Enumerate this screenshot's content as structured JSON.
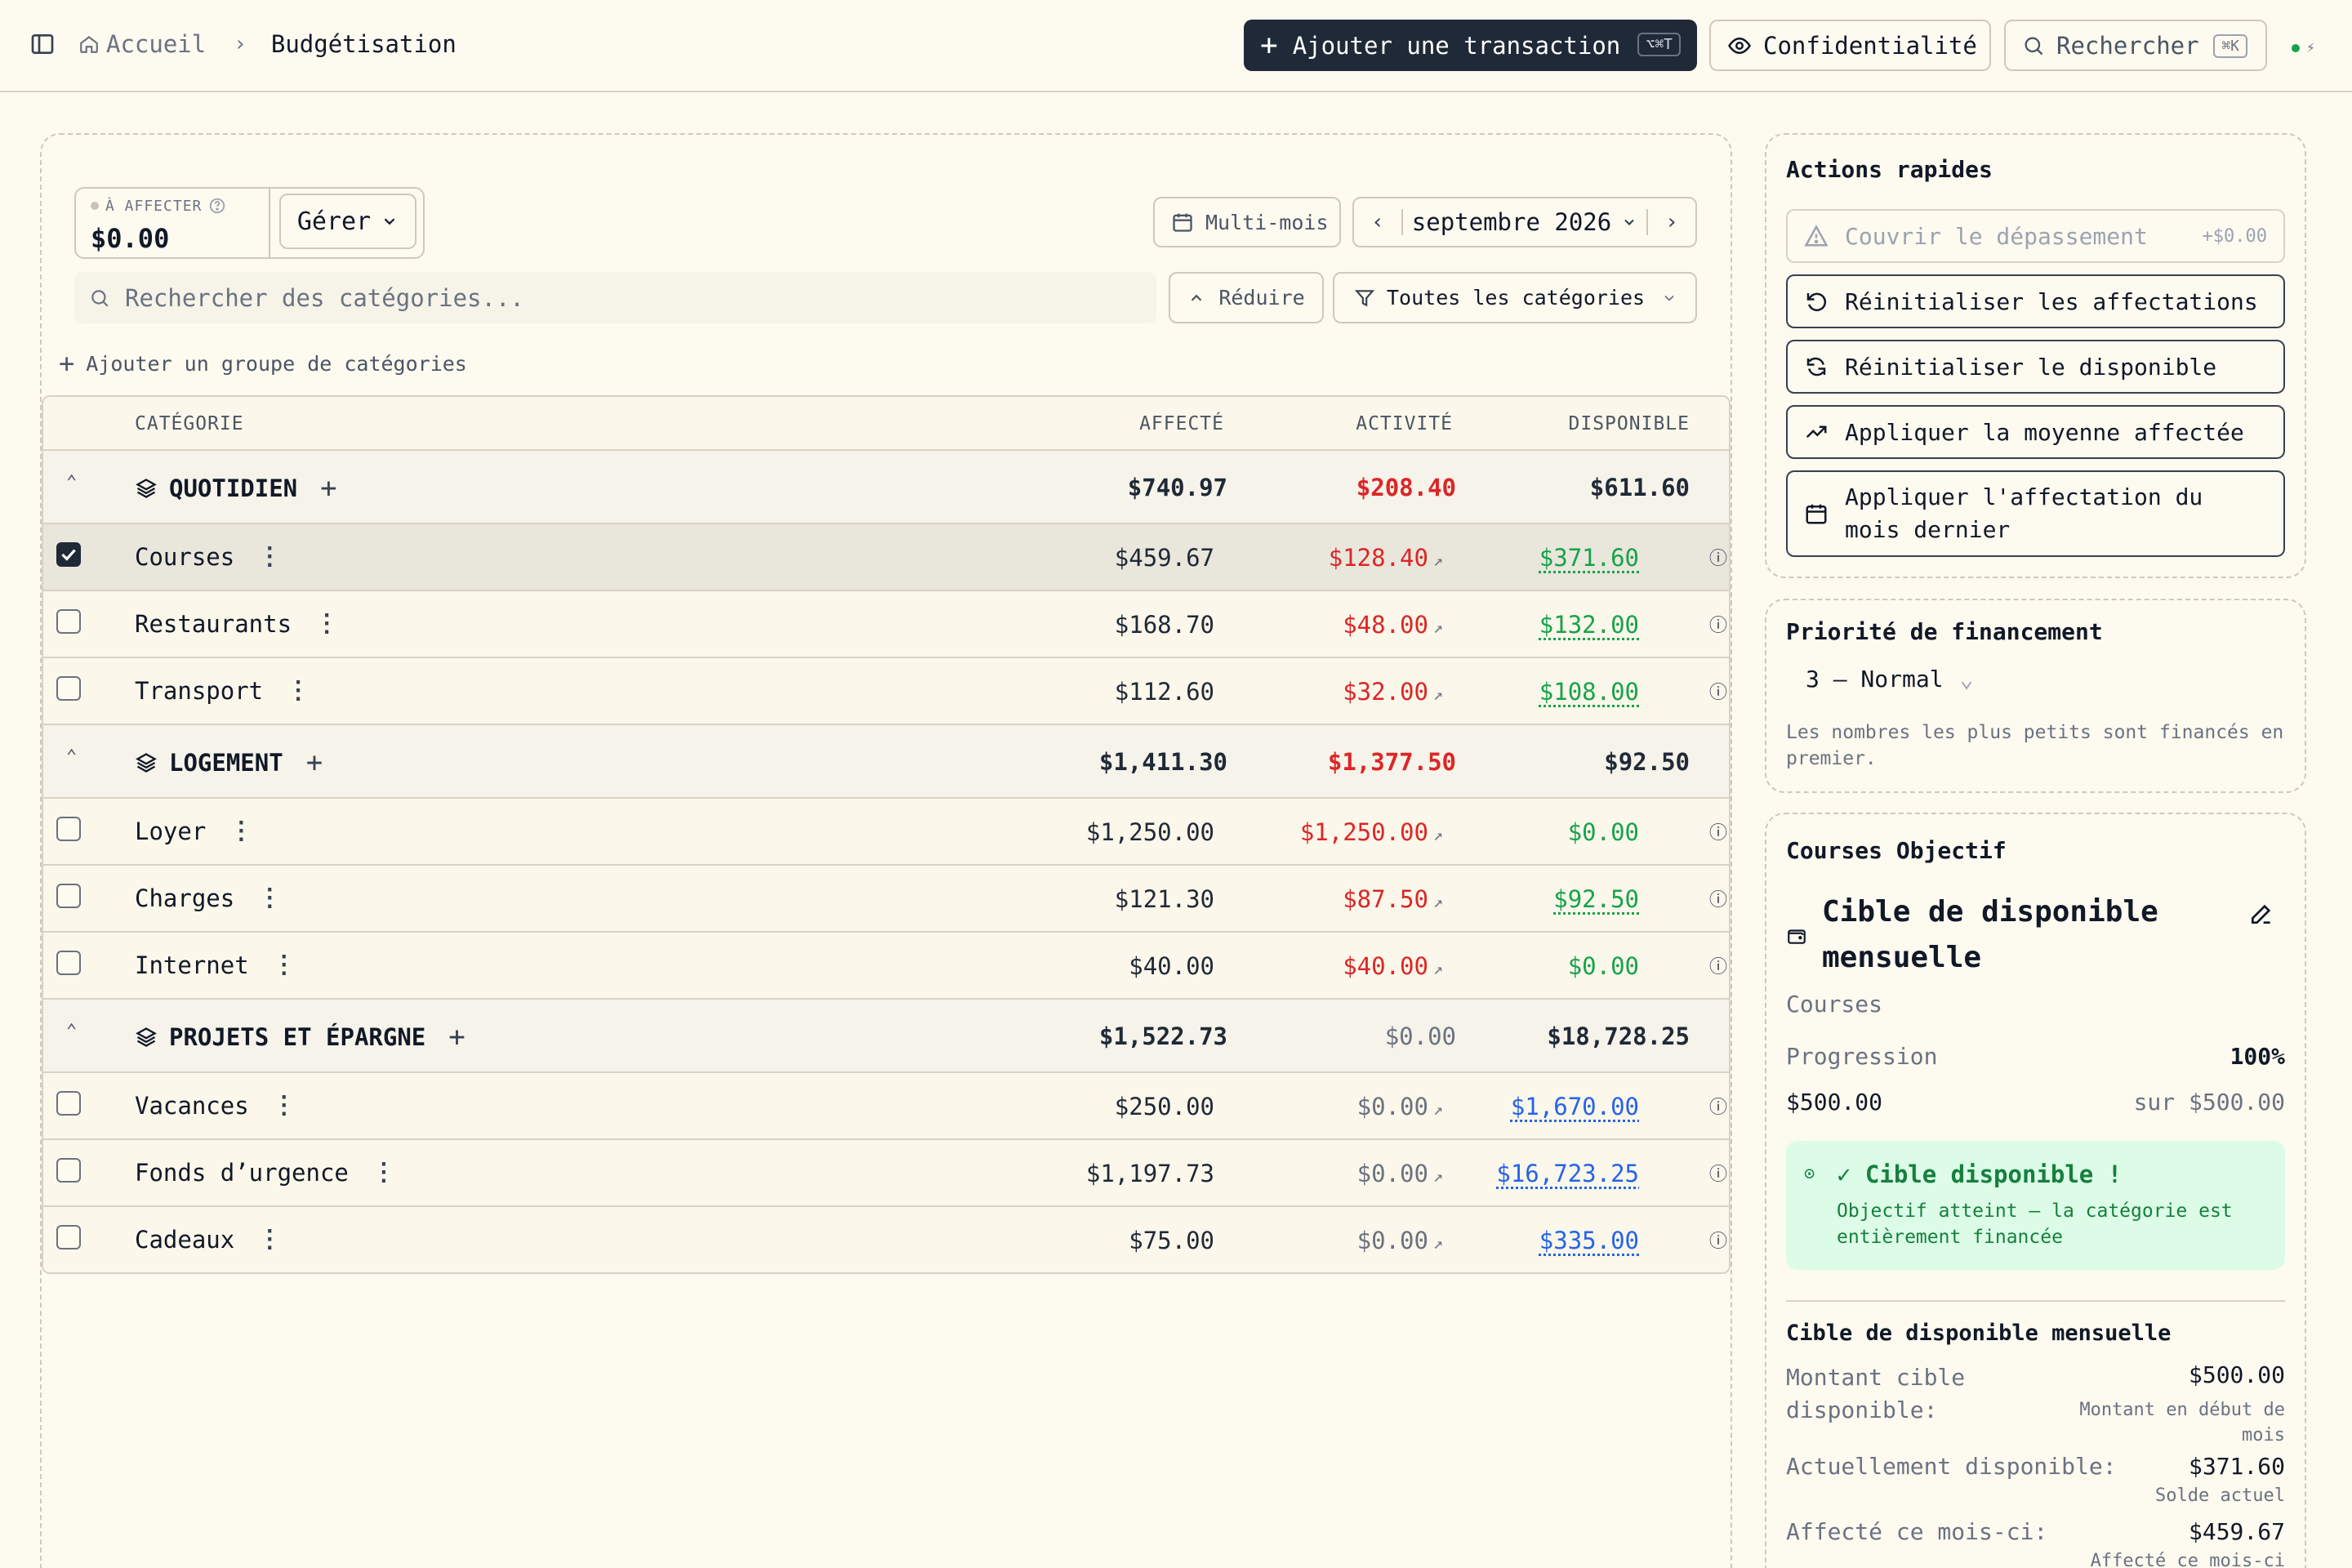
{
  "header": {
    "breadcrumb_home": "Accueil",
    "breadcrumb_current": "Budgétisation",
    "add_transaction_label": "Ajouter une transaction",
    "add_transaction_kbd": "⌥⌘T",
    "privacy_label": "Confidentialité",
    "search_label": "Rechercher",
    "search_kbd": "⌘K",
    "status_bolt": "⚡"
  },
  "toolbar": {
    "to_assign_label": "À AFFECTER",
    "to_assign_amount": "$0.00",
    "manage_label": "Gérer",
    "multi_month_label": "Multi-mois",
    "month_label": "septembre 2026",
    "search_placeholder": "Rechercher des catégories...",
    "reduce_label": "Réduire",
    "filter_label": "Toutes les catégories",
    "add_group_label": "Ajouter un groupe de catégories"
  },
  "table": {
    "headers": {
      "category": "CATÉGORIE",
      "assigned": "AFFECTÉ",
      "activity": "ACTIVITÉ",
      "available": "DISPONIBLE"
    },
    "groups": [
      {
        "name": "QUOTIDIEN",
        "assigned": "$740.97",
        "activity": "$208.40",
        "available": "$611.60",
        "items": [
          {
            "name": "Courses",
            "assigned": "$459.67",
            "activity": "$128.40",
            "available": "$371.60",
            "checked": true
          },
          {
            "name": "Restaurants",
            "assigned": "$168.70",
            "activity": "$48.00",
            "available": "$132.00"
          },
          {
            "name": "Transport",
            "assigned": "$112.60",
            "activity": "$32.00",
            "available": "$108.00"
          }
        ]
      },
      {
        "name": "LOGEMENT",
        "assigned": "$1,411.30",
        "activity": "$1,377.50",
        "available": "$92.50",
        "items": [
          {
            "name": "Loyer",
            "assigned": "$1,250.00",
            "activity": "$1,250.00",
            "available": "$0.00"
          },
          {
            "name": "Charges",
            "assigned": "$121.30",
            "activity": "$87.50",
            "available": "$92.50"
          },
          {
            "name": "Internet",
            "assigned": "$40.00",
            "activity": "$40.00",
            "available": "$0.00"
          }
        ]
      },
      {
        "name": "PROJETS ET ÉPARGNE",
        "assigned": "$1,522.73",
        "activity": "$0.00",
        "available": "$18,728.25",
        "items": [
          {
            "name": "Vacances",
            "assigned": "$250.00",
            "activity": "$0.00",
            "available": "$1,670.00"
          },
          {
            "name": "Fonds d’urgence",
            "assigned": "$1,197.73",
            "activity": "$0.00",
            "available": "$16,723.25"
          },
          {
            "name": "Cadeaux",
            "assigned": "$75.00",
            "activity": "$0.00",
            "available": "$335.00"
          }
        ]
      }
    ]
  },
  "quick_actions": {
    "title": "Actions rapides",
    "cover_overspend": "Couvrir le dépassement",
    "cover_amount": "+$0.00",
    "reset_assignments": "Réinitialiser les affectations",
    "reset_available": "Réinitialiser le disponible",
    "apply_average": "Appliquer la moyenne affectée",
    "apply_last_month": "Appliquer l'affectation du mois dernier"
  },
  "priority": {
    "title": "Priorité de financement",
    "value": "3 — Normal",
    "hint": "Les nombres les plus petits sont financés en premier."
  },
  "goal": {
    "title": "Courses Objectif",
    "type": "Cible de disponible mensuelle",
    "category": "Courses",
    "progress_label": "Progression",
    "progress_value": "100%",
    "current": "$500.00",
    "target": "sur $500.00",
    "success_title": "✓ Cible disponible !",
    "success_desc": "Objectif atteint — la catégorie est entièrement financée",
    "details_title": "Cible de disponible mensuelle",
    "target_amount_label": "Montant cible disponible:",
    "target_amount_value": "$500.00",
    "target_amount_note": "Montant en début de mois",
    "currently_available_label": "Actuellement disponible:",
    "currently_available_value": "$371.60",
    "currently_available_note": "Solde actuel",
    "assigned_month_label": "Affecté ce mois-ci:",
    "assigned_month_value": "$459.67",
    "assigned_month_note": "Affecté ce mois-ci"
  },
  "colors": {
    "primary": "#1f2937",
    "negative": "#dc2626",
    "positive": "#16a34a",
    "link": "#2563eb",
    "background": "#fdfaf0"
  }
}
